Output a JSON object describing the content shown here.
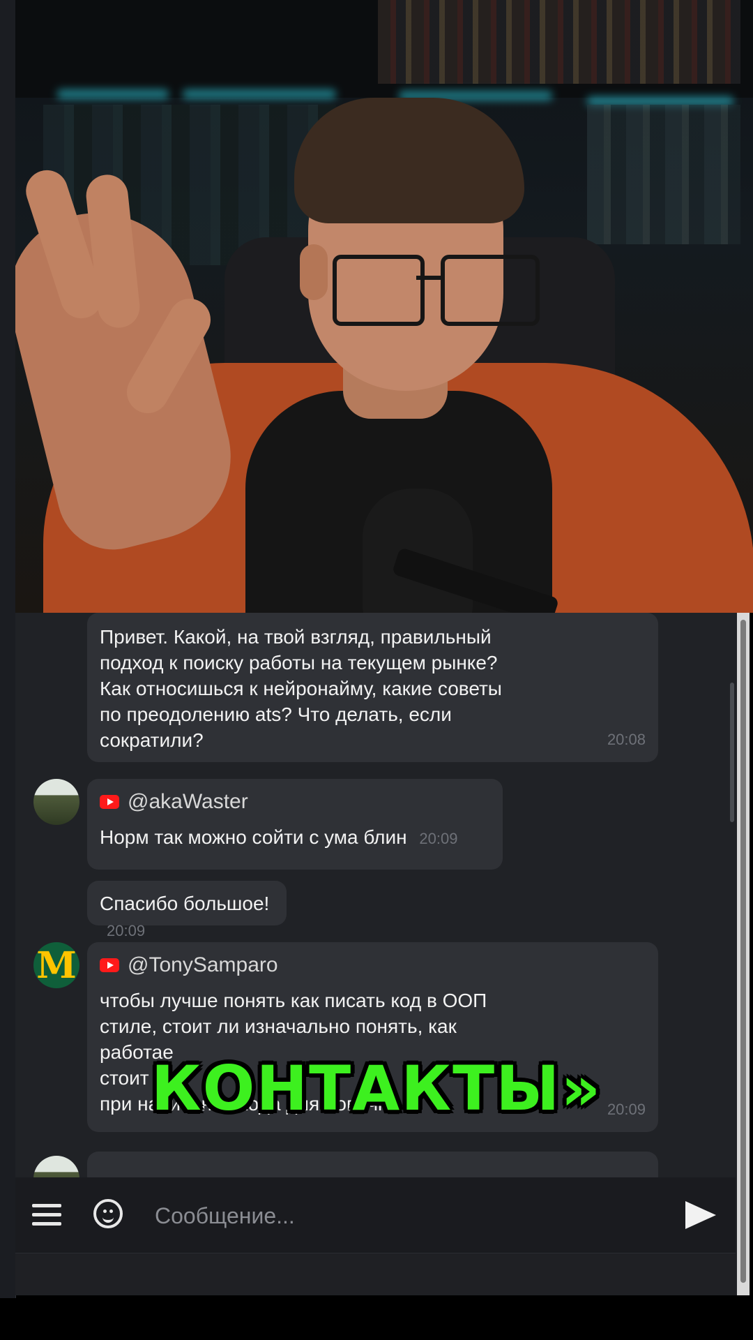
{
  "messages": [
    {
      "text_lines": [
        "Привет. Какой, на твой взгляд, правильный",
        "подход к поиску работы на текущем рынке?",
        "Как относишься к нейронайму, какие советы",
        "по преодолению ats? Что делать, если",
        "сократили?"
      ],
      "time": "20:08"
    },
    {
      "author": "@akaWaster",
      "text": "Норм так можно сойти с ума блин",
      "time": "20:09"
    },
    {
      "text": "Спасибо большое!",
      "time": "20:09"
    },
    {
      "author": "@TonySamparo",
      "text_lines": [
        "чтобы лучше понять как писать код в ООП",
        "стиле, стоит ли изначально понять, как",
        "работае",
        "стоит п",
        "при написании кода для новичка."
      ],
      "time": "20:09",
      "avatar_letter": "M"
    }
  ],
  "composer": {
    "placeholder": "Сообщение..."
  },
  "caption": "КОНТАКТЫ»",
  "colors": {
    "chat_bg": "#202226",
    "bubble_bg": "#2f3136",
    "caption": "#3df01f",
    "jacket": "#b04a22"
  }
}
